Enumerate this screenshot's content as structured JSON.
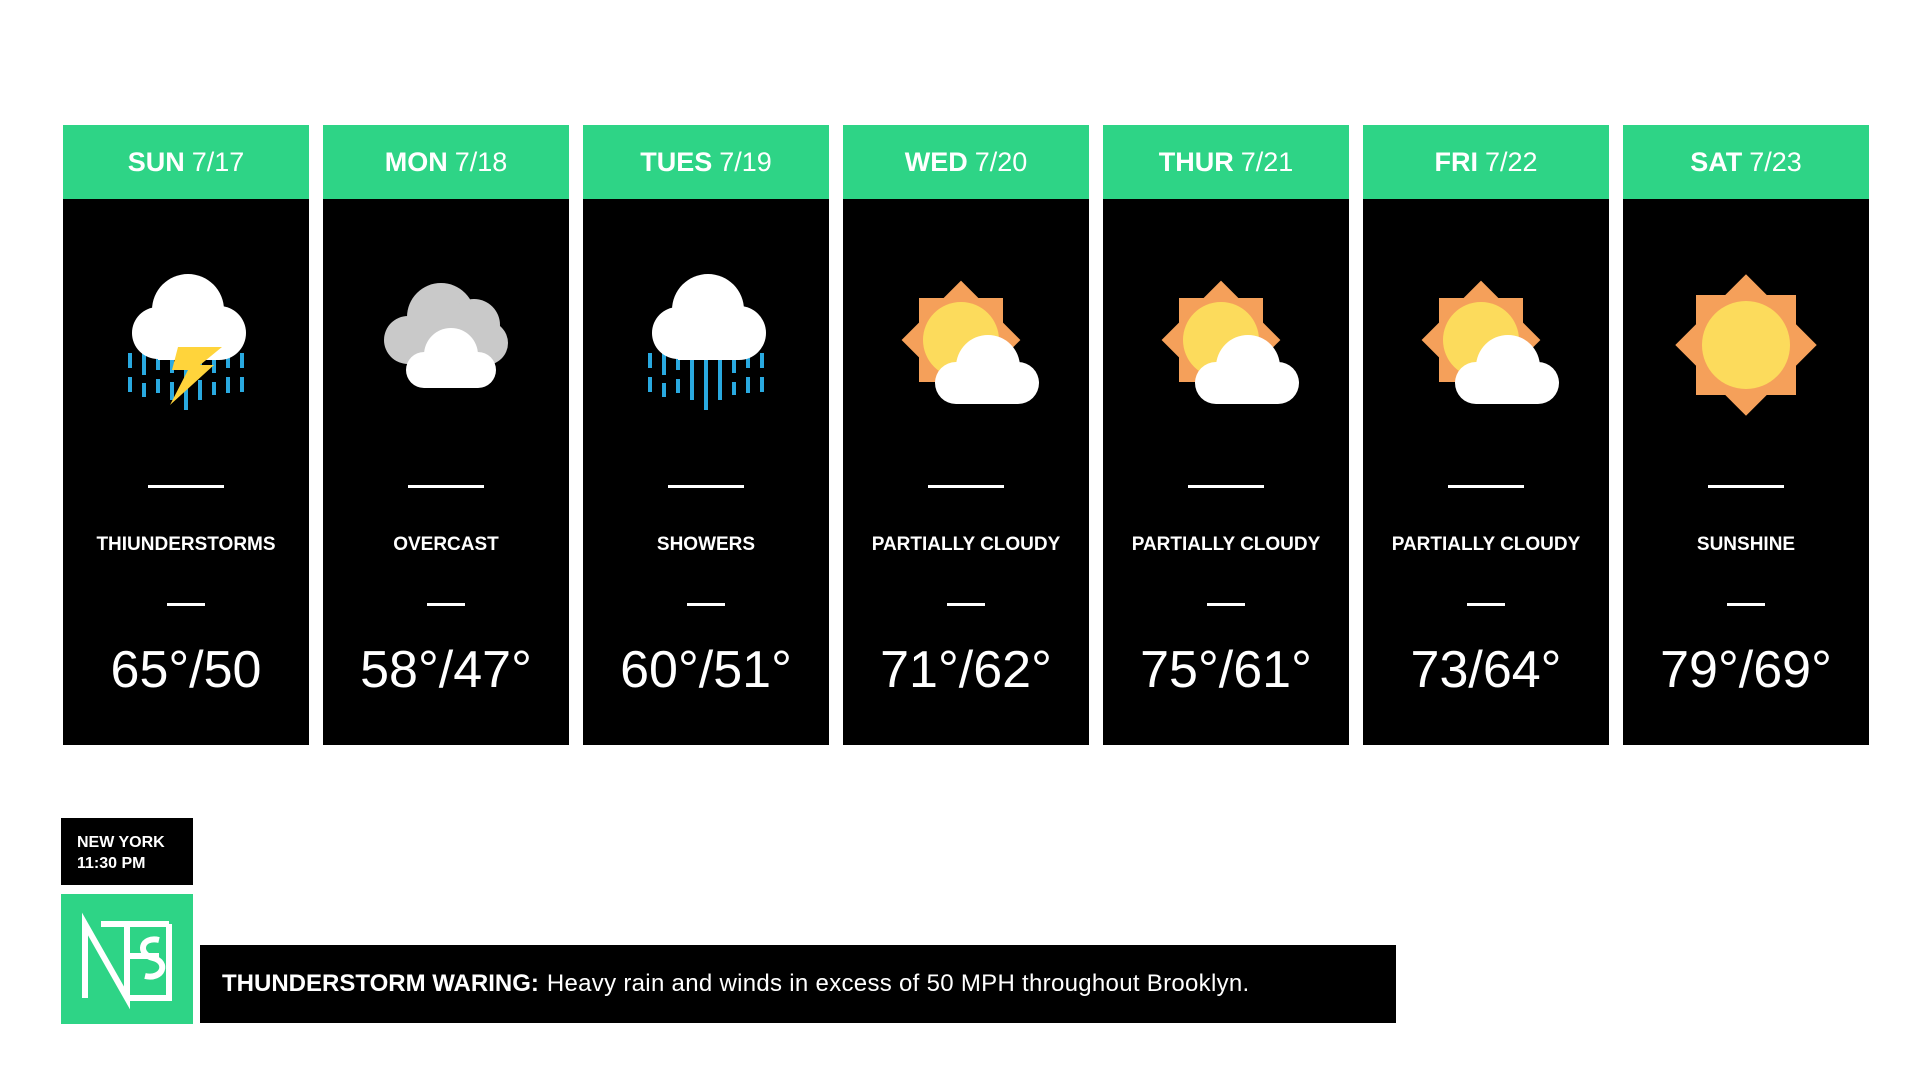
{
  "forecast": {
    "days": [
      {
        "day": "SUN",
        "date": "7/17",
        "condition": "THIUNDERSTORMS",
        "temp": "65°/50",
        "icon": "thunderstorm-icon"
      },
      {
        "day": "MON",
        "date": "7/18",
        "condition": "OVERCAST",
        "temp": "58°/47°",
        "icon": "overcast-icon"
      },
      {
        "day": "TUES",
        "date": "7/19",
        "condition": "SHOWERS",
        "temp": "60°/51°",
        "icon": "showers-icon"
      },
      {
        "day": "WED",
        "date": "7/20",
        "condition": "PARTIALLY CLOUDY",
        "temp": "71°/62°",
        "icon": "partly-cloudy-icon"
      },
      {
        "day": "THUR",
        "date": "7/21",
        "condition": "PARTIALLY CLOUDY",
        "temp": "75°/61°",
        "icon": "partly-cloudy-icon"
      },
      {
        "day": "FRI",
        "date": "7/22",
        "condition": "PARTIALLY CLOUDY",
        "temp": "73/64°",
        "icon": "partly-cloudy-icon"
      },
      {
        "day": "SAT",
        "date": "7/23",
        "condition": "SUNSHINE",
        "temp": "79°/69°",
        "icon": "sunshine-icon"
      }
    ]
  },
  "location": {
    "city": "NEW YORK",
    "time": "11:30 PM"
  },
  "logo": {
    "icon": "network-logo-icon"
  },
  "alert": {
    "label": "THUNDERSTORM WARING:",
    "text": "Heavy rain and winds in excess of 50 MPH throughout Brooklyn."
  },
  "colors": {
    "accent_green": "#2ed486",
    "card_black": "#000000",
    "sun_yellow": "#fcdb5c",
    "sun_orange": "#f5a05a",
    "cloud_white": "#ffffff",
    "cloud_gray": "#c9c9c9",
    "rain_blue": "#29a9e0",
    "bolt_yellow": "#ffd43b"
  }
}
